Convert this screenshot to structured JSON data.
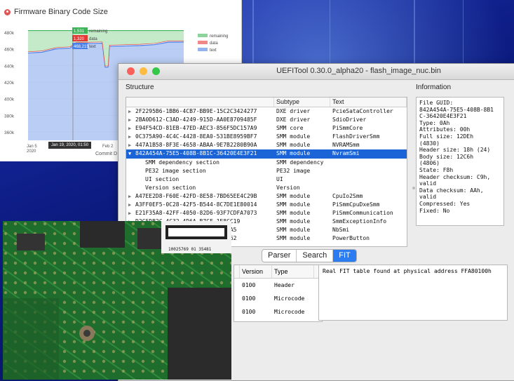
{
  "chart_card": {
    "title": "Firmware Binary Code Size",
    "tooltip_date": "Jan 19, 2020, 01:50",
    "commit_label": "Commit D",
    "chart_data": {
      "type": "area",
      "title": "Firmware Binary Code Size",
      "yticks": [
        "480k",
        "460k",
        "440k",
        "420k",
        "400k",
        "380k",
        "360k"
      ],
      "xticks": [
        "Jan 5 2020",
        "Feb 2"
      ],
      "ylim": [
        350000,
        485000
      ],
      "legend": [
        "remaining",
        "data",
        "text"
      ],
      "tooltip": [
        {
          "series": "remaining",
          "value": "1,531"
        },
        {
          "series": "data",
          "value": "1,320"
        },
        {
          "series": "text",
          "value": "468,215"
        }
      ],
      "series_colors": {
        "remaining": "#3fb55a",
        "data": "#e53935",
        "text": "#4a7ee8"
      }
    }
  },
  "window": {
    "title": "UEFITool 0.30.0_alpha20 - flash_image_nuc.bin",
    "structure_label": "Structure",
    "information_label": "Information",
    "columns": [
      "",
      "Subtype",
      "Text"
    ],
    "rows": [
      {
        "arrow": "▶",
        "name": "2F2295B6-1BB6-4CB7-BB9E-15C2C3424277",
        "subtype": "DXE driver",
        "text": "PcieSataController"
      },
      {
        "arrow": "▶",
        "name": "2BA0D612-C3AD-4249-915D-AA0E8709485F",
        "subtype": "DXE driver",
        "text": "SdioDriver"
      },
      {
        "arrow": "▶",
        "name": "E94F54CD-81EB-47ED-AEC3-856F5DC157A9",
        "subtype": "SMM core",
        "text": "PiSmmCore"
      },
      {
        "arrow": "▶",
        "name": "0C375A90-4C4C-4428-8EA0-531BE8959BF7",
        "subtype": "SMM module",
        "text": "FlashDriverSmm"
      },
      {
        "arrow": "▶",
        "name": "447A1B58-8F3E-4658-ABAA-9E7B2280B90A",
        "subtype": "SMM module",
        "text": "NVRAMSmm"
      },
      {
        "arrow": "▼",
        "name": "842A454A-75E5-408B-8B1C-36420E4E3F21",
        "subtype": "SMM module",
        "text": "NvramSmi",
        "selected": true
      },
      {
        "arrow": "",
        "name": "SMM dependency section",
        "subtype": "SMM dependency",
        "text": "",
        "indent": true
      },
      {
        "arrow": "",
        "name": "PE32 image section",
        "subtype": "PE32 image",
        "text": "",
        "indent": true
      },
      {
        "arrow": "",
        "name": "UI section",
        "subtype": "UI",
        "text": "",
        "indent": true
      },
      {
        "arrow": "",
        "name": "Version section",
        "subtype": "Version",
        "text": "",
        "indent": true
      },
      {
        "arrow": "▶",
        "name": "A47EE2D8-F60E-42FD-8E58-7BD65EE4C29B",
        "subtype": "SMM module",
        "text": "CpuIo2Smm"
      },
      {
        "arrow": "▶",
        "name": "A3FF0EF5-0C28-42F5-B544-8C7DE1E80014",
        "subtype": "SMM module",
        "text": "PiSmmCpuDxeSmm"
      },
      {
        "arrow": "▶",
        "name": "E21F35A8-42FF-4050-82D6-93F7CDFA7073",
        "subtype": "SMM module",
        "text": "PiSmmCommunication"
      },
      {
        "arrow": "▶",
        "name": "D2C5DB2C-4C32-4D6A-B7CF-1E8CC19",
        "subtype": "SMM module",
        "text": "SmmExceptionInfo"
      },
      {
        "arrow": "▶",
        "name": "2D6E3F2A-0B3C-4E9C-8F9F244E5A5",
        "subtype": "SMM module",
        "text": "NbSmi"
      },
      {
        "arrow": "▶",
        "name": "7F0F2B8C-9E1D-4A6E-B0F7C180C62",
        "subtype": "SMM module",
        "text": "PowerButton"
      }
    ],
    "info_lines": [
      "File GUID:",
      "842A454A-75E5-408B-8B1",
      "C-36420E4E3F21",
      "Type: 0Ah",
      "Attributes: 00h",
      "Full size: 12DEh",
      "(4830)",
      "Header size: 18h (24)",
      "Body size: 12C6h",
      "(4806)",
      "State: F8h",
      "Header checksum: C9h,",
      "valid",
      "Data checksum: AAh,",
      "valid",
      "Compressed: Yes",
      "Fixed: No"
    ],
    "tabs": [
      "Parser",
      "Search",
      "FIT"
    ],
    "active_tab": "FIT",
    "fit_columns": [
      "Version",
      "Type"
    ],
    "fit_rows": [
      {
        "version": "0100",
        "type": "Header"
      },
      {
        "version": "0100",
        "type": "Microcode"
      },
      {
        "version": "0100",
        "type": "Microcode"
      }
    ],
    "fit_message": "Real FIT table found at physical address FFA80100h"
  },
  "pcb": {
    "label_text": "10025769 01 35481"
  }
}
